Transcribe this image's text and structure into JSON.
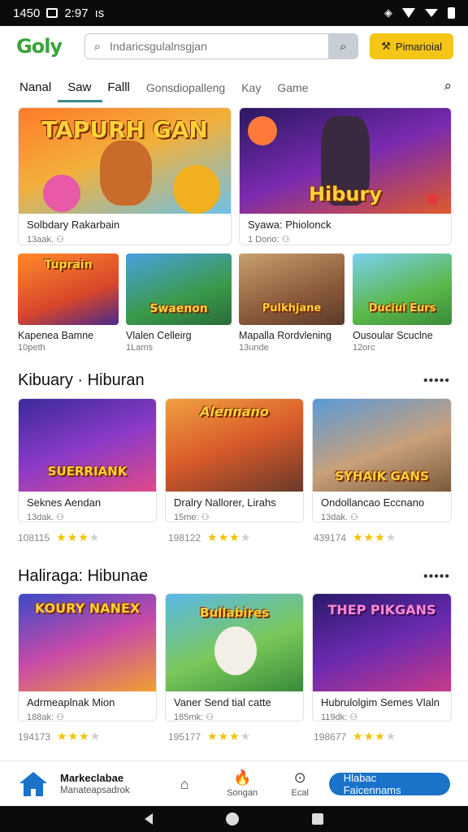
{
  "status": {
    "time": "1450",
    "time2": "2:97",
    "extra": "ıs"
  },
  "appbar": {
    "logo": "Goly",
    "search_placeholder": "Indaricsgulalnsgjan",
    "cta_label": "Pimarioial",
    "cta_icon": "pickaxe-icon",
    "accent": "#f5c518"
  },
  "tabs": [
    {
      "label": "Nanal"
    },
    {
      "label": "Saw"
    },
    {
      "label": "Falll"
    },
    {
      "label": "Gonsdiopalleng"
    },
    {
      "label": "Kay"
    },
    {
      "label": "Game"
    }
  ],
  "featured": [
    {
      "art_title": "TAPURH GAN",
      "title": "Solbdary Rakarbain",
      "sub": "13aak.  ⚇"
    },
    {
      "art_title": "Hibury",
      "title": "Syawa: Phiolonck",
      "sub": "1 Dorio:  ⚇"
    }
  ],
  "small_row": [
    {
      "art_title": "Tuprain",
      "title": "Kapenea Bamne",
      "sub": "10peth"
    },
    {
      "art_title": "Swaenon",
      "title": "Vlalen Celleirg",
      "sub": "1Lams"
    },
    {
      "art_title": "Pulkhjane",
      "title": "Mapalla Rordvlening",
      "sub": "13unde"
    },
    {
      "art_title": "Duciul Eurs",
      "title": "Ousoular Scuclne",
      "sub": "12orc"
    }
  ],
  "section1": {
    "title": "Kibuary · Hiburan",
    "more": "•••••",
    "items": [
      {
        "art_title": "SUERRIANK",
        "title": "Seknes Aendan",
        "sub": "13dak.  ⚇",
        "count": "108115",
        "stars": 3
      },
      {
        "art_title": "Alennano",
        "title": "Dralry Nallorer, Lirahs",
        "sub": "15me:  ⚇",
        "count": "198122",
        "stars": 3
      },
      {
        "art_title": "SYHAIK GANS",
        "title": "Ondollancao Eccnano",
        "sub": "13dak.  ⚇",
        "count": "439174",
        "stars": 3
      }
    ]
  },
  "section2": {
    "title": "Haliraga: Hibunae",
    "more": "•••••",
    "items": [
      {
        "art_title": "KOURY NANEX",
        "title": "Adrmeaplnak Mion",
        "sub": "188ak:  ⚇",
        "count": "194173",
        "stars": 3
      },
      {
        "art_title": "Bullabires",
        "title": "Vaner Send tial catte",
        "sub": "185mk:  ⚇",
        "count": "195177",
        "stars": 3
      },
      {
        "art_title": "THEP PIKGANS",
        "title": "Hubrulolgim Semes Vlaln",
        "sub": "119dk:  ⚇",
        "count": "198677",
        "stars": 3
      }
    ]
  },
  "bottomnav": {
    "home_title": "Markeclabae",
    "home_sub": "Manateapsadrok",
    "items": [
      {
        "icon": "house-outline-icon",
        "label": ""
      },
      {
        "icon": "fire-icon",
        "label": "Songan"
      },
      {
        "icon": "chat-icon",
        "label": "Ecal"
      }
    ],
    "pill": "Hlabac Faicennams",
    "brand": "#1a73c9"
  }
}
